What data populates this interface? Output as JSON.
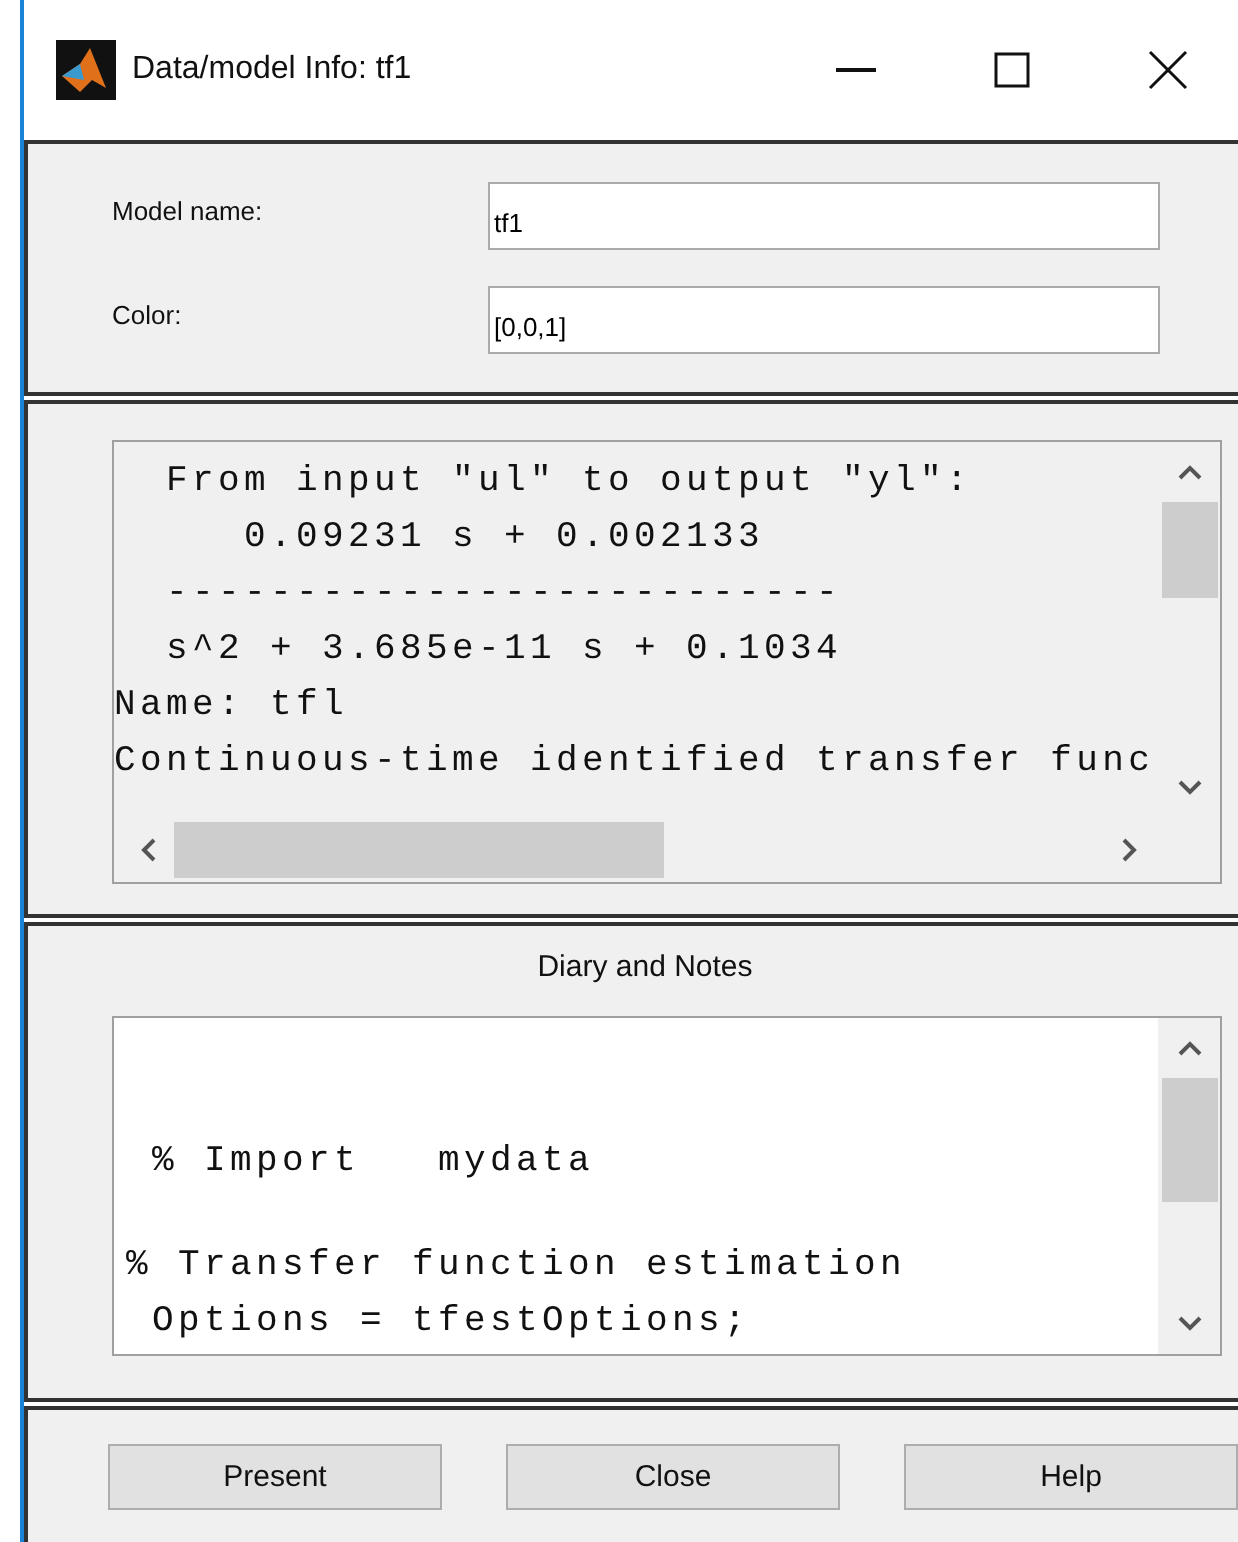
{
  "window": {
    "title": "Data/model Info: tf1"
  },
  "fields": [
    {
      "label": "Model name:",
      "value": "tf1"
    },
    {
      "label": "Color:",
      "value": "[0,0,1]"
    }
  ],
  "model_text": {
    "lines": [
      "  From input \"ul\" to output \"yl\":",
      "     0.09231 s + 0.002133",
      "  --------------------------",
      "  s^2 + 3.685e-11 s + 0.1034",
      "Name: tfl",
      "Continuous-time identified transfer func"
    ]
  },
  "diary": {
    "title": "Diary and Notes",
    "lines": [
      " % Import   mydata",
      "% Transfer function estimation",
      " Options = tfestOptions;"
    ]
  },
  "buttons": [
    "Present",
    "Close",
    "Help"
  ]
}
